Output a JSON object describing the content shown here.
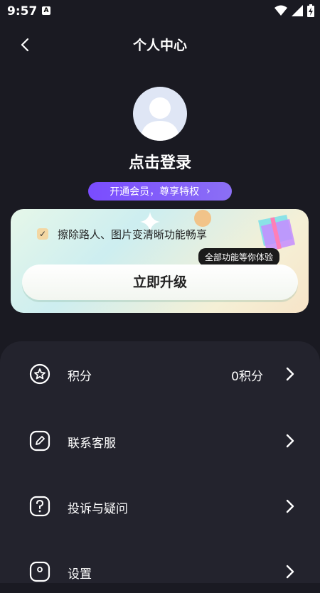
{
  "status": {
    "time": "9:57",
    "a_icon": "A"
  },
  "header": {
    "title": "个人中心"
  },
  "profile": {
    "login_text": "点击登录",
    "vip_text": "开通会员，尊享特权",
    "vip_chevron": "›"
  },
  "promo": {
    "check": "✓",
    "feature_text": "擦除路人、图片变清晰功能畅享",
    "tip_text": "全部功能等你体验",
    "upgrade_label": "立即升级"
  },
  "menu": [
    {
      "label": "积分",
      "value": "0积分",
      "icon": "star-icon"
    },
    {
      "label": "联系客服",
      "icon": "pencil-icon"
    },
    {
      "label": "投诉与疑问",
      "icon": "question-icon"
    },
    {
      "label": "设置",
      "icon": "settings-icon"
    }
  ],
  "colors": {
    "background": "#1a1a22",
    "sheet": "#23232d",
    "vip_purple": "#7a4cff"
  }
}
